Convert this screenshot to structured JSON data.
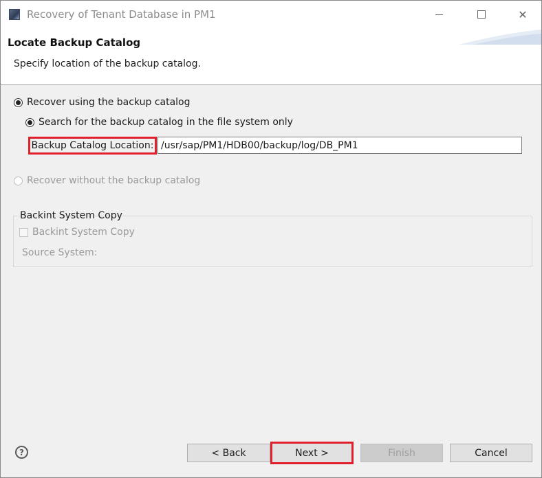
{
  "window": {
    "title": "Recovery of Tenant Database in PM1",
    "icon": "sap-hana-studio-icon"
  },
  "header": {
    "title": "Locate Backup Catalog",
    "description": "Specify location of the backup catalog."
  },
  "options": {
    "recover_with_catalog": {
      "label": "Recover using the backup catalog",
      "selected": true
    },
    "search_file_system": {
      "label": "Search for the backup catalog in the file system only",
      "selected": true
    },
    "catalog_location": {
      "label": "Backup Catalog Location:",
      "value": "/usr/sap/PM1/HDB00/backup/log/DB_PM1"
    },
    "recover_without_catalog": {
      "label": "Recover without the backup catalog",
      "selected": false,
      "enabled": false
    }
  },
  "backint": {
    "group_title": "Backint System Copy",
    "checkbox_label": "Backint System Copy",
    "checked": false,
    "source_system_label": "Source System:"
  },
  "footer": {
    "back_label": "< Back",
    "next_label": "Next >",
    "finish_label": "Finish",
    "cancel_label": "Cancel"
  },
  "colors": {
    "highlight": "#e0202c",
    "body_background": "#f0f0f0"
  }
}
